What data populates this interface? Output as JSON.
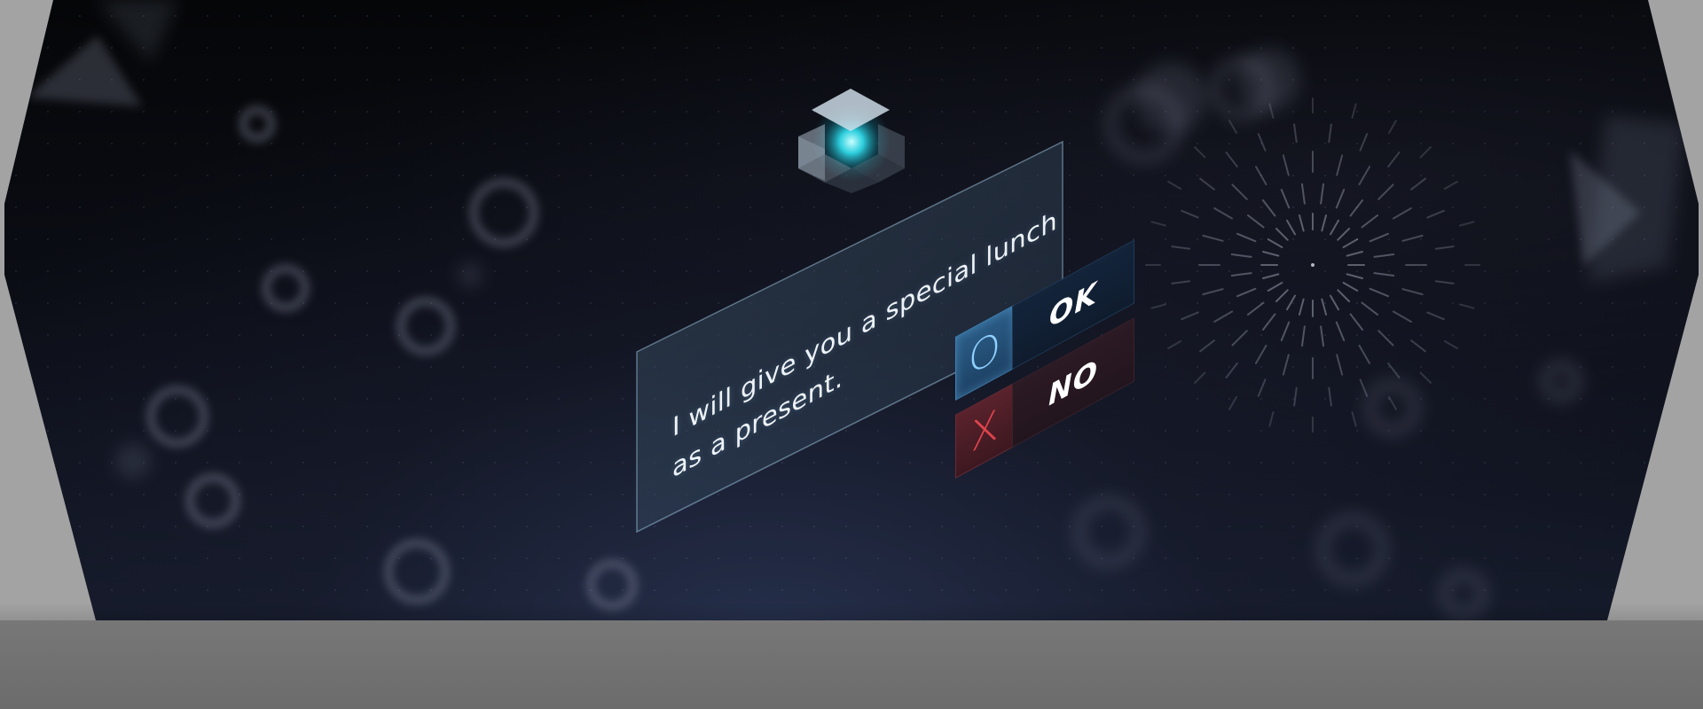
{
  "dialog": {
    "line1": "I will give you a special lunch",
    "line2": "as a present."
  },
  "choices": [
    {
      "key": "O",
      "label": "OK",
      "color": "#3f82b8"
    },
    {
      "key": "X",
      "label": "NO",
      "color": "#e0444d"
    }
  ],
  "icons": {
    "speaker": "glowing-cube-icon",
    "effect": "radial-burst-icon"
  },
  "colors": {
    "background": "#0b0d15",
    "accent": "#2fd8e8",
    "ok": "#3f82b8",
    "no": "#e0444d"
  }
}
